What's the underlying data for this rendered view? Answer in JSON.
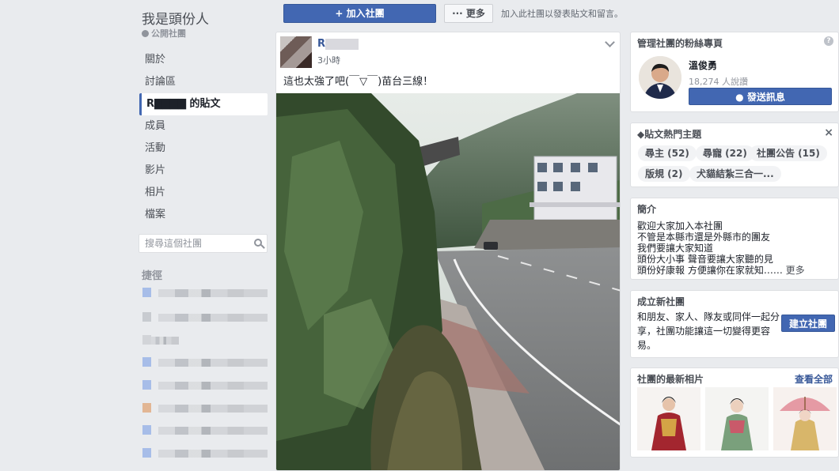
{
  "group": {
    "name": "我是頭份人",
    "privacy": "公開社團"
  },
  "nav": {
    "items": [
      {
        "label": "關於"
      },
      {
        "label": "討論區"
      },
      {
        "label": "R▇▇▇▇ 的貼文"
      },
      {
        "label": "成員"
      },
      {
        "label": "活動"
      },
      {
        "label": "影片"
      },
      {
        "label": "相片"
      },
      {
        "label": "檔案"
      }
    ]
  },
  "search": {
    "placeholder": "搜尋這個社團"
  },
  "shortcuts": {
    "title": "捷徑"
  },
  "topbar": {
    "join_label": "+ 加入社團",
    "more_label": "··· 更多",
    "hint": "加入此社團以發表貼文和留言。"
  },
  "post": {
    "author": "R",
    "time": "3小時",
    "text": "這也太強了吧(￣▽￣)苗台三線！"
  },
  "admin": {
    "title": "管理社團的粉絲專頁",
    "name": "溫俊勇",
    "likes": "18,274 人說讚",
    "message_label": "發送訊息"
  },
  "topics": {
    "title": "貼文熱門主題",
    "tags": [
      "尋主 (52)",
      "尋寵 (22)",
      "社團公告 (15)",
      "版規 (2)",
      "犬貓結紮三合一..."
    ]
  },
  "intro": {
    "title": "簡介",
    "lines": [
      "歡迎大家加入本社團",
      "不管是本縣市還是外縣市的團友",
      "我們要讓大家知道",
      "頭份大小事 聲音要讓大家聽的見",
      "頭份好康報 方便讓你在家就知……"
    ],
    "more": "更多"
  },
  "create": {
    "title": "成立新社團",
    "text": "和朋友、家人、隊友或同伴一起分享，社團功能讓這一切變得更容易。",
    "button": "建立社團"
  },
  "photos": {
    "title": "社團的最新相片",
    "see_all": "查看全部"
  },
  "colors": {
    "fb_blue": "#4267b2",
    "link_blue": "#385898",
    "background": "#e9ebee"
  }
}
